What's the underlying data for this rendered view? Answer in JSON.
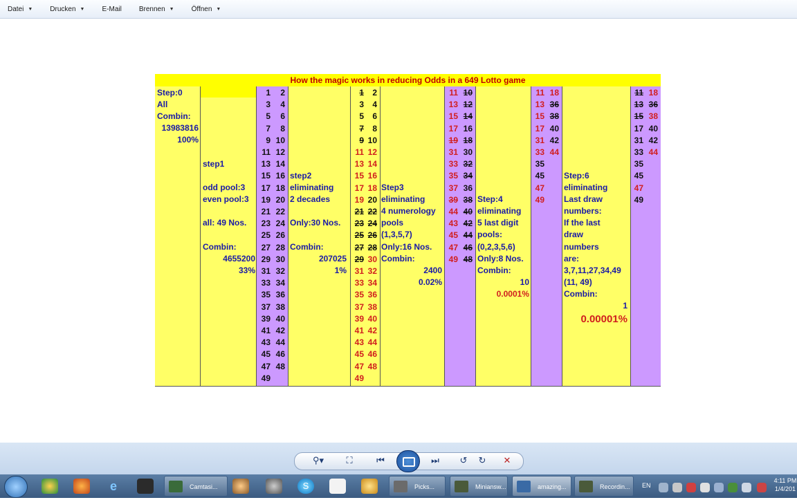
{
  "menu": [
    {
      "label": "Datei",
      "has_arrow": true
    },
    {
      "label": "Drucken",
      "has_arrow": true
    },
    {
      "label": "E-Mail",
      "has_arrow": false
    },
    {
      "label": "Brennen",
      "has_arrow": true
    },
    {
      "label": "Öffnen",
      "has_arrow": true
    }
  ],
  "sheet": {
    "title": "How  the magic works in reducing Odds in a 649 Lotto game",
    "step0": [
      "Step:0",
      "All",
      "Combin:",
      "13983816",
      "100%"
    ],
    "step1": {
      "label": "step1",
      "lines": [
        "odd pool:3",
        "even pool:3",
        "",
        "all: 49 Nos.",
        "",
        "Combin:"
      ],
      "combin": "4655200",
      "pct": "33%"
    },
    "step2": {
      "lines": [
        "step2",
        "eliminating",
        "2 decades",
        "",
        "Only:30 Nos.",
        "",
        "Combin:"
      ],
      "combin": "207025",
      "pct": "1%"
    },
    "step3": {
      "lines": [
        "Step3",
        "eliminating",
        "4 numerology",
        "pools",
        "(1,3,5,7)",
        "Only:16 Nos.",
        "Combin:"
      ],
      "combin": "2400",
      "pct": "0.02%"
    },
    "step4": {
      "lines": [
        "Step:4",
        "eliminating",
        "5 last digit",
        "pools:",
        "(0,2,3,5,6)",
        "Only:8 Nos.",
        "Combin:"
      ],
      "combin": "10",
      "pct": "0.0001%"
    },
    "step6": {
      "lines": [
        "Step:6",
        "eliminating",
        "Last draw",
        "numbers:",
        "If the last",
        "draw",
        "numbers",
        "are:",
        "3,7,11,27,34,49",
        "(11, 49)",
        "Combin:"
      ],
      "combin": "1",
      "pct": "0.00001%"
    },
    "col_a": [
      "1",
      "2",
      "3",
      "4",
      "5",
      "6",
      "7",
      "8",
      "9",
      "10",
      "11",
      "12",
      "13",
      "14",
      "15",
      "16",
      "17",
      "18",
      "19",
      "20",
      "21",
      "22",
      "23",
      "24",
      "25",
      "26",
      "27",
      "28",
      "29",
      "30",
      "31",
      "32",
      "33",
      "34",
      "35",
      "36",
      "37",
      "38",
      "39",
      "40",
      "41",
      "42",
      "43",
      "44",
      "45",
      "46",
      "47",
      "48",
      "49"
    ],
    "col_b": [
      "1",
      "2",
      "3",
      "4",
      "5",
      "6",
      "7",
      "8",
      "9",
      "10",
      "11",
      "12",
      "13",
      "14",
      "15",
      "16",
      "17",
      "18",
      "19",
      "20",
      "21",
      "22",
      "23",
      "24",
      "25",
      "26",
      "27",
      "28",
      "29",
      "30",
      "31",
      "32",
      "33",
      "34",
      "35",
      "36",
      "37",
      "38",
      "39",
      "40",
      "41",
      "42",
      "43",
      "44",
      "45",
      "46",
      "47",
      "48",
      "49"
    ],
    "col_c": [
      "11",
      "10",
      "13",
      "12",
      "15",
      "14",
      "17",
      "16",
      "19",
      "18",
      "31",
      "30",
      "33",
      "32",
      "35",
      "34",
      "37",
      "36",
      "39",
      "38",
      "44",
      "40",
      "43",
      "42",
      "45",
      "44",
      "47",
      "46",
      "49",
      "48"
    ],
    "col_d": [
      "11",
      "18",
      "13",
      "36",
      "15",
      "38",
      "17",
      "40",
      "31",
      "42",
      "33",
      "44",
      "35",
      "",
      "45",
      "",
      "47",
      "",
      "49",
      ""
    ],
    "col_e": [
      "11",
      "18",
      "13",
      "36",
      "15",
      "38",
      "17",
      "40",
      "31",
      "42",
      "33",
      "44",
      "35",
      "",
      "45",
      "",
      "47",
      "",
      "49",
      ""
    ]
  },
  "taskbar": {
    "buttons": [
      "Camtasi...",
      "Picks...",
      "Miniansw...",
      "amazing...",
      "Recordin..."
    ],
    "lang": "EN",
    "time": "4:11 PM",
    "date": "1/4/201"
  }
}
